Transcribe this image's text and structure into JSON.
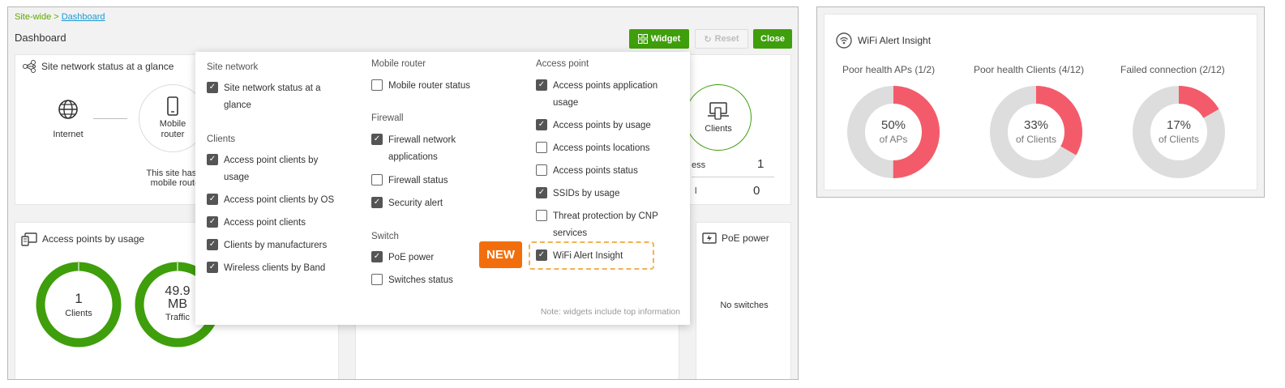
{
  "breadcrumb": {
    "parent": "Site-wide >",
    "current": "Dashboard"
  },
  "page_title": "Dashboard",
  "toolbar": {
    "widget_label": "Widget",
    "reset_label": "Reset",
    "close_label": "Close"
  },
  "status_card": {
    "title": "Site network status at a glance",
    "internet_label": "Internet",
    "mobile_router_label": "Mobile\nrouter",
    "message": "This site has no\nmobile router.",
    "clients_label": "Clients",
    "row1_label": "ess",
    "row1_value": "1",
    "row2_label": "l",
    "row2_value": "0"
  },
  "ap_card": {
    "title": "Access points by usage",
    "donut1_value": "1",
    "donut1_label": "Clients",
    "donut2_value": "49.9",
    "donut2_unit": "MB",
    "donut2_label": "Traffic"
  },
  "poe_card": {
    "title": "PoE power",
    "message": "No switches"
  },
  "widget_menu": {
    "site_network_heading": "Site network",
    "site_network": [
      {
        "label": "Site network status at a glance",
        "checked": true
      }
    ],
    "clients_heading": "Clients",
    "clients": [
      {
        "label": "Access point clients by usage",
        "checked": true
      },
      {
        "label": "Access point clients by OS",
        "checked": true
      },
      {
        "label": "Access point clients",
        "checked": true
      },
      {
        "label": "Clients by manufacturers",
        "checked": true
      },
      {
        "label": "Wireless clients by Band",
        "checked": true
      }
    ],
    "mobile_router_heading": "Mobile router",
    "mobile_router": [
      {
        "label": "Mobile router status",
        "checked": false
      }
    ],
    "firewall_heading": "Firewall",
    "firewall": [
      {
        "label": "Firewall network applications",
        "checked": true
      },
      {
        "label": "Firewall status",
        "checked": false
      },
      {
        "label": "Security alert",
        "checked": true
      }
    ],
    "switch_heading": "Switch",
    "switch": [
      {
        "label": "PoE power",
        "checked": true
      },
      {
        "label": "Switches status",
        "checked": false
      }
    ],
    "access_point_heading": "Access point",
    "access_point": [
      {
        "label": "Access points application usage",
        "checked": true
      },
      {
        "label": "Access points by usage",
        "checked": true
      },
      {
        "label": "Access points locations",
        "checked": false
      },
      {
        "label": "Access points status",
        "checked": false
      },
      {
        "label": "SSIDs by usage",
        "checked": true
      },
      {
        "label": "Threat protection by CNP services",
        "checked": false
      },
      {
        "label": "WiFi Alert Insight",
        "checked": true
      }
    ],
    "new_badge": "NEW",
    "note": "Note: widgets include top information"
  },
  "wifi_alert_insight": {
    "title": "WiFi Alert Insight",
    "donuts": [
      {
        "caption": "Poor health APs (1/2)",
        "percent_text": "50%",
        "sub": "of APs",
        "fraction": 0.5
      },
      {
        "caption": "Poor health Clients (4/12)",
        "percent_text": "33%",
        "sub": "of Clients",
        "fraction": 0.333
      },
      {
        "caption": "Failed connection (2/12)",
        "percent_text": "17%",
        "sub": "of Clients",
        "fraction": 0.167
      }
    ]
  },
  "colors": {
    "accent_green": "#3f9e0b",
    "alert_red": "#f45b6a",
    "new_orange": "#f26e0d",
    "donut_gray": "#dddddd"
  }
}
